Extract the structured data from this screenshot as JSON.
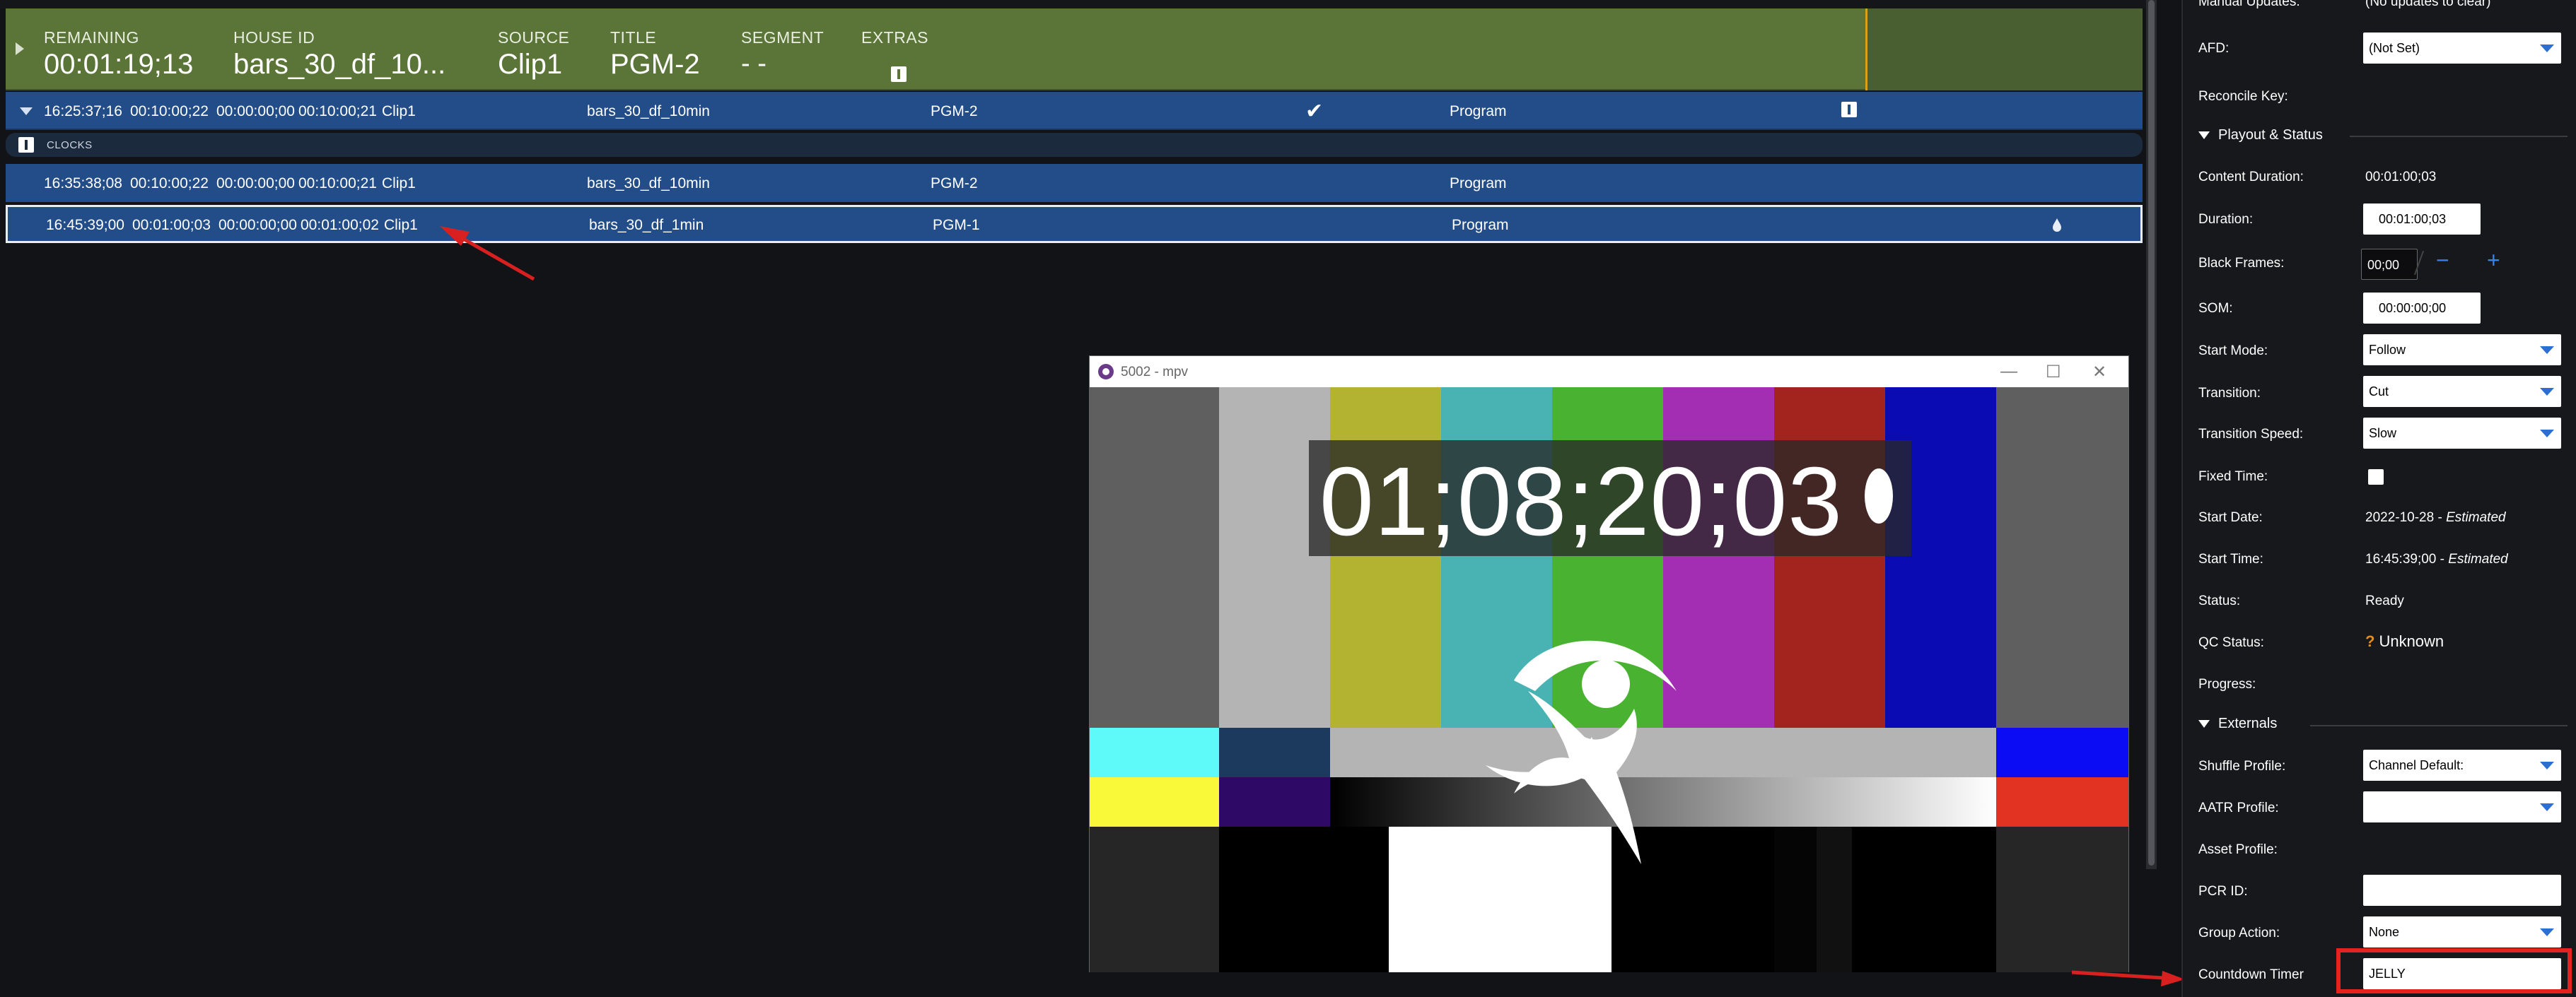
{
  "header": {
    "remaining_label": "REMAINING",
    "remaining_value": "00:01:19;13",
    "house_id_label": "HOUSE ID",
    "house_id_value": "bars_30_df_10...",
    "source_label": "SOURCE",
    "source_value": "Clip1",
    "title_label": "TITLE",
    "title_value": "PGM-2",
    "segment_label": "SEGMENT",
    "segment_value": "- -",
    "extras_label": "EXTRAS"
  },
  "rows": [
    {
      "time": "16:25:37;16",
      "dur1": "00:10:00;22",
      "som": "00:00:00;00",
      "dur2": "00:10:00;21",
      "source": "Clip1",
      "house_id": "bars_30_df_10min",
      "title": "PGM-2",
      "type": "Program"
    },
    {
      "time": "16:35:38;08",
      "dur1": "00:10:00;22",
      "som": "00:00:00;00",
      "dur2": "00:10:00;21",
      "source": "Clip1",
      "house_id": "bars_30_df_10min",
      "title": "PGM-2",
      "type": "Program"
    },
    {
      "time": "16:45:39;00",
      "dur1": "00:01:00;03",
      "som": "00:00:00;00",
      "dur2": "00:01:00;02",
      "source": "Clip1",
      "house_id": "bars_30_df_1min",
      "title": "PGM-1",
      "type": "Program"
    }
  ],
  "clocks_label": "CLOCKS",
  "mpv": {
    "title": "5002 - mpv",
    "timecode": "01;08;20;03"
  },
  "panel": {
    "manual_updates_label": "Manual Updates:",
    "manual_updates_value": "(No updates to clear)",
    "afd_label": "AFD:",
    "afd_value": "(Not Set)",
    "reconcile_label": "Reconcile Key:",
    "playout_section": "Playout & Status",
    "content_duration_label": "Content Duration:",
    "content_duration_value": "00:01:00;03",
    "duration_label": "Duration:",
    "duration_value": "00:01:00;03",
    "black_frames_label": "Black Frames:",
    "black_frames_value": "00;00",
    "som_label": "SOM:",
    "som_value": "00:00:00;00",
    "start_mode_label": "Start Mode:",
    "start_mode_value": "Follow",
    "transition_label": "Transition:",
    "transition_value": "Cut",
    "transition_speed_label": "Transition Speed:",
    "transition_speed_value": "Slow",
    "fixed_time_label": "Fixed Time:",
    "start_date_label": "Start Date:",
    "start_date_value": "2022-10-28",
    "start_date_note": "Estimated",
    "start_time_label": "Start Time:",
    "start_time_value": "16:45:39;00",
    "start_time_note": "Estimated",
    "status_label": "Status:",
    "status_value": "Ready",
    "qc_status_label": "QC Status:",
    "qc_status_mark": "?",
    "qc_status_value": "Unknown",
    "progress_label": "Progress:",
    "externals_section": "Externals",
    "shuffle_profile_label": "Shuffle Profile:",
    "shuffle_profile_value": "Channel Default:",
    "aatr_profile_label": "AATR Profile:",
    "aatr_profile_value": "",
    "asset_profile_label": "Asset Profile:",
    "pcr_id_label": "PCR ID:",
    "pcr_id_value": "",
    "group_action_label": "Group Action:",
    "group_action_value": "None",
    "countdown_timer_label": "Countdown Timer",
    "countdown_timer_value": "JELLY",
    "minus_symbol": "−",
    "plus_symbol": "+"
  },
  "colors": {
    "header_green": "#5a7537",
    "row_blue": "#234d88",
    "accent_blue": "#2d6fd1",
    "annotation_red": "#e32222"
  }
}
